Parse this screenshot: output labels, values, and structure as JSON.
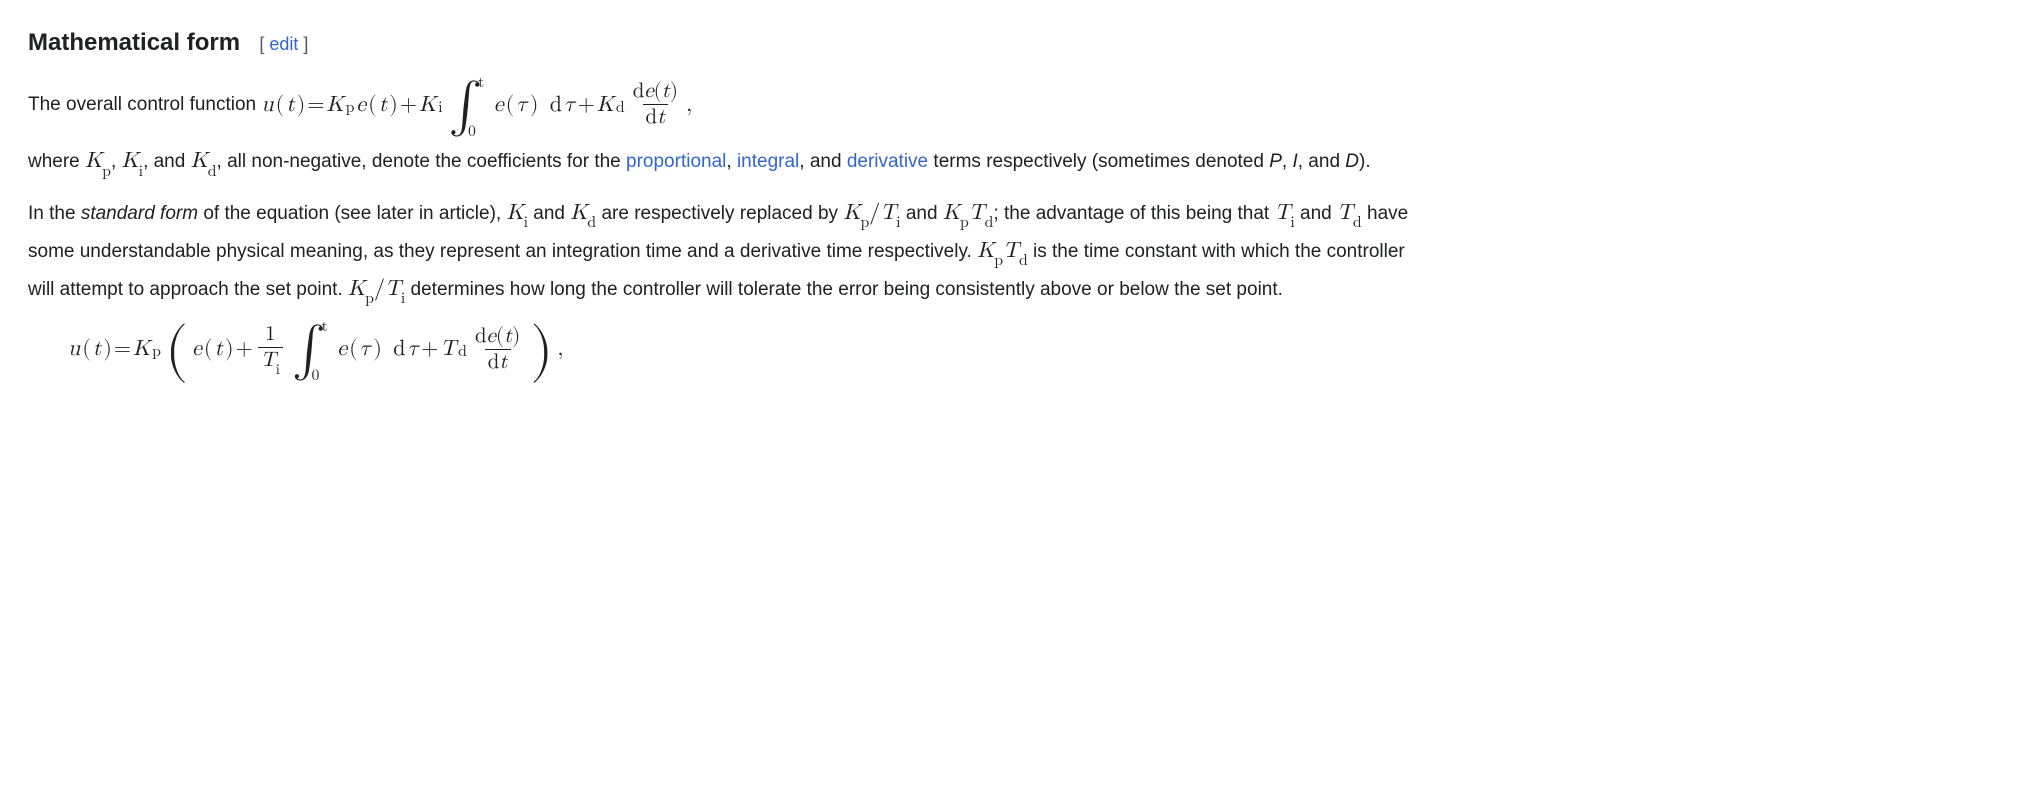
{
  "heading": "Mathematical form",
  "edit_open": "[ ",
  "edit_label": "edit",
  "edit_close": " ]",
  "p1_lead": "The overall control function ",
  "p1_trail": ",",
  "p2_a": "where ",
  "p2_b": ", ",
  "p2_c": ", and ",
  "p2_d": ", all non-negative, denote the coefficients for the ",
  "link_proportional": "proportional",
  "p2_e": ", ",
  "link_integral": "integral",
  "p2_f": ", and ",
  "link_derivative": "derivative",
  "p2_g": " terms respectively (sometimes denoted ",
  "p2_h": ", ",
  "p2_i": ", and ",
  "p2_j": ").",
  "p3_a": "In the ",
  "p3_std": "standard form",
  "p3_b": " of the equation (see later in article), ",
  "p3_c": " and ",
  "p3_d": " are respectively replaced by ",
  "p3_e": " and ",
  "p3_f": "; the advantage of this being that ",
  "p3_g": " and ",
  "p3_h": " have some understandable physical meaning, as they represent an integration time and a derivative time respectively. ",
  "p3_i": " is the time constant with which the controller will attempt to approach the set point. ",
  "p3_j": " determines how long the controller will tolerate the error being consistently above or below the set point.",
  "sym": {
    "Kp": "K",
    "Kp_sub": "p",
    "Ki": "K",
    "Ki_sub": "i",
    "Kd": "K",
    "Kd_sub": "d",
    "Ti": "T",
    "Ti_sub": "i",
    "Td": "T",
    "Td_sub": "d",
    "P": "P",
    "I": "I",
    "D": "D",
    "u": "u",
    "e": "e",
    "t": "t",
    "tau": "τ",
    "d": "d",
    "eq": " = ",
    "plus": " + ",
    "slash": "/",
    "comma": " ,",
    "int": "∫",
    "int_lo": "0",
    "int_hi": "t",
    "lp": "(",
    "rp": ")",
    "num1": "1"
  }
}
